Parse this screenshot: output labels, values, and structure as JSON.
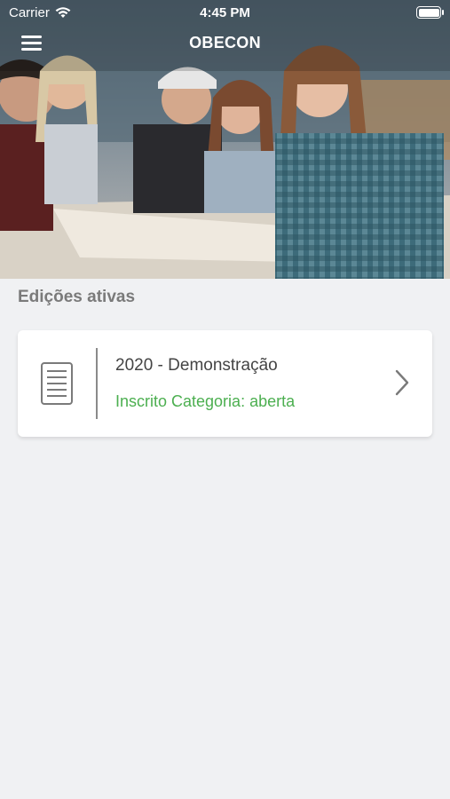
{
  "status_bar": {
    "carrier": "Carrier",
    "time": "4:45 PM"
  },
  "nav": {
    "title": "OBECON",
    "menu_icon": "hamburger-menu-icon"
  },
  "section": {
    "title": "Edições ativas"
  },
  "edition": {
    "title": "2020 - Demonstração",
    "status": "Inscrito Categoria: aberta",
    "icon": "document-icon",
    "chevron": "chevron-right-icon",
    "status_color": "#4caf50"
  }
}
